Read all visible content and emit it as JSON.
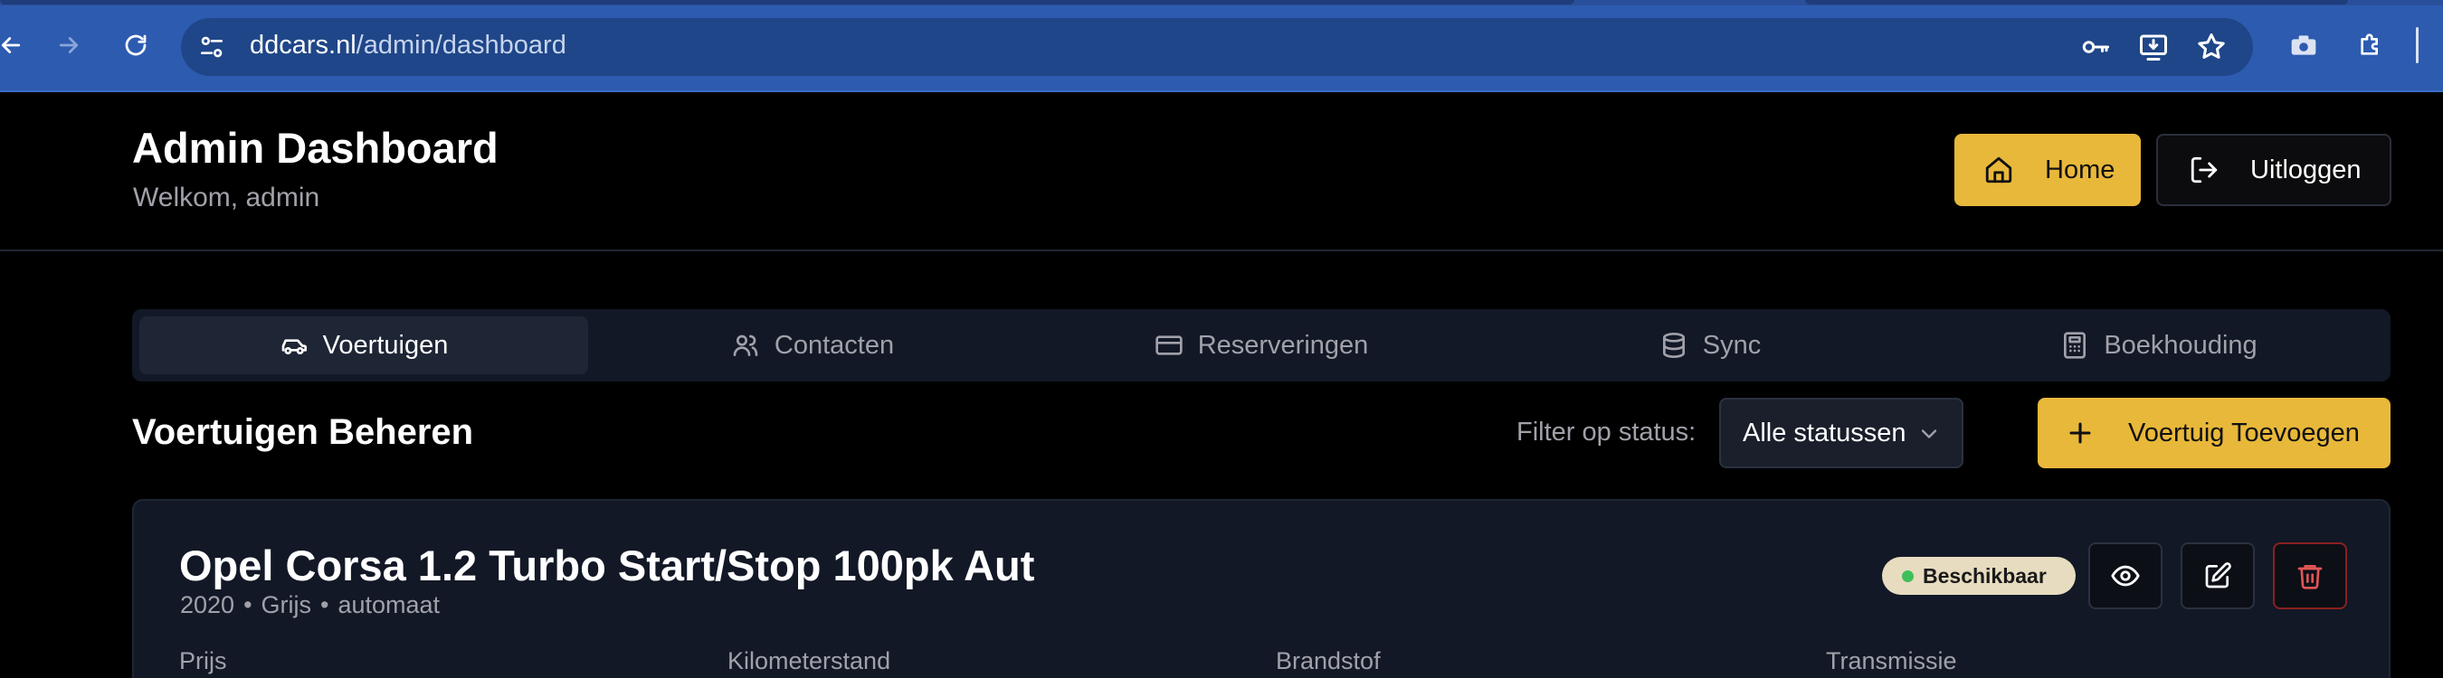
{
  "browser": {
    "url_host": "ddcars.nl",
    "url_path": "/admin/dashboard",
    "icons": [
      "back-icon",
      "forward-icon",
      "reload-icon",
      "site-info-icon",
      "key-icon",
      "install-app-icon",
      "star-icon",
      "camera-icon",
      "extensions-icon"
    ]
  },
  "header": {
    "title": "Admin Dashboard",
    "subtitle": "Welkom, admin",
    "home_label": "Home",
    "logout_label": "Uitloggen"
  },
  "tabs": [
    {
      "label": "Voertuigen",
      "icon": "car-icon",
      "active": true
    },
    {
      "label": "Contacten",
      "icon": "users-icon",
      "active": false
    },
    {
      "label": "Reserveringen",
      "icon": "credit-card-icon",
      "active": false
    },
    {
      "label": "Sync",
      "icon": "database-icon",
      "active": false
    },
    {
      "label": "Boekhouding",
      "icon": "calculator-icon",
      "active": false
    }
  ],
  "section": {
    "title": "Voertuigen Beheren",
    "filter_label": "Filter op status:",
    "filter_value": "Alle statussen",
    "add_label": "Voertuig Toevoegen"
  },
  "vehicle": {
    "title": "Opel Corsa 1.2 Turbo Start/Stop 100pk Aut",
    "year": "2020",
    "color": "Grijs",
    "transmission": "automaat",
    "status": "Beschikbaar",
    "status_color": "#3fbf5a",
    "fields": [
      "Prijs",
      "Kilometerstand",
      "Brandstof",
      "Transmissie"
    ]
  },
  "colors": {
    "accent": "#e8b83a",
    "chrome": "#2d5bb0",
    "danger": "#dc2626"
  }
}
